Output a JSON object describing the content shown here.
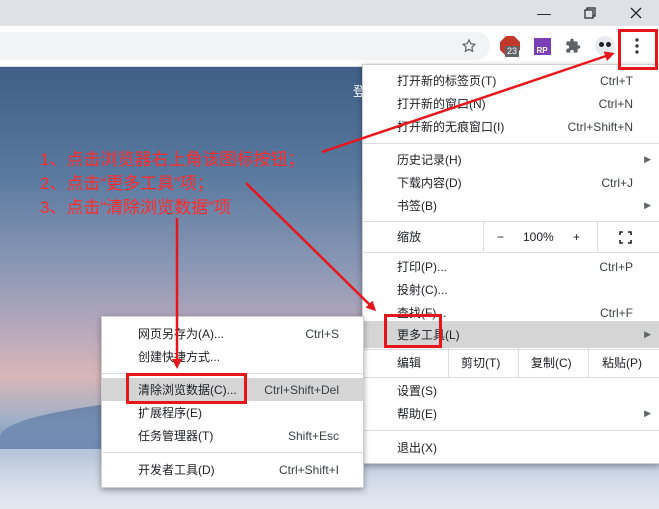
{
  "window": {
    "minimize_icon": "minimize-icon",
    "restore_icon": "restore-icon",
    "close_icon": "close-icon"
  },
  "toolbar": {
    "bookmark_icon": "star-icon",
    "adblock_badge": "23",
    "extension_rp_label": "RP",
    "extensions_icon": "puzzle-icon",
    "menu_icon": "kebab-menu-icon"
  },
  "page": {
    "visible_text": "登"
  },
  "main_menu": {
    "items": [
      {
        "label": "打开新的标签页(T)",
        "shortcut": "Ctrl+T"
      },
      {
        "label": "打开新的窗口(N)",
        "shortcut": "Ctrl+N"
      },
      {
        "label": "打开新的无痕窗口(I)",
        "shortcut": "Ctrl+Shift+N"
      },
      {
        "label": "历史记录(H)",
        "shortcut": ""
      },
      {
        "label": "下载内容(D)",
        "shortcut": "Ctrl+J"
      },
      {
        "label": "书签(B)",
        "shortcut": ""
      },
      {
        "label": "打印(P)...",
        "shortcut": "Ctrl+P"
      },
      {
        "label": "投射(C)...",
        "shortcut": ""
      },
      {
        "label": "查找(F)...",
        "shortcut": "Ctrl+F"
      },
      {
        "label": "更多工具(L)",
        "shortcut": ""
      },
      {
        "label": "设置(S)",
        "shortcut": ""
      },
      {
        "label": "帮助(E)",
        "shortcut": ""
      },
      {
        "label": "退出(X)",
        "shortcut": ""
      }
    ],
    "zoom": {
      "label": "缩放",
      "minus": "−",
      "value": "100%",
      "plus": "+"
    },
    "edit": {
      "label": "编辑",
      "cut": "剪切(T)",
      "copy": "复制(C)",
      "paste": "粘贴(P)"
    }
  },
  "sub_menu": {
    "items": [
      {
        "label": "网页另存为(A)...",
        "shortcut": "Ctrl+S"
      },
      {
        "label": "创建快捷方式...",
        "shortcut": ""
      },
      {
        "label": "清除浏览数据(C)...",
        "shortcut": "Ctrl+Shift+Del"
      },
      {
        "label": "扩展程序(E)",
        "shortcut": ""
      },
      {
        "label": "任务管理器(T)",
        "shortcut": "Shift+Esc"
      },
      {
        "label": "开发者工具(D)",
        "shortcut": "Ctrl+Shift+I"
      }
    ]
  },
  "instructions": [
    "1、点击浏览器右上角该图标按钮；",
    "2、点击“更多工具”项；",
    "3、点击“清除浏览数据”项"
  ],
  "colors": {
    "annotation_red": "#e8161b",
    "highlight": "#d5d5d5"
  }
}
